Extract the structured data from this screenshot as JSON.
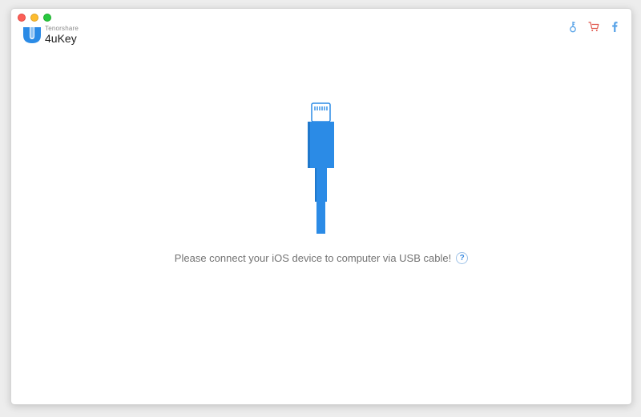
{
  "app": {
    "vendor": "Tenorshare",
    "name": "4uKey"
  },
  "colors": {
    "accent": "#2b8be6",
    "cart": "#e0584e",
    "key": "#5aa4e8",
    "facebook": "#5aa4e8"
  },
  "header": {
    "actions": [
      {
        "icon": "key-icon"
      },
      {
        "icon": "cart-icon"
      },
      {
        "icon": "facebook-icon"
      }
    ]
  },
  "main": {
    "illustration": "lightning-cable-icon",
    "message": "Please connect your iOS device to computer via USB cable!",
    "help_label": "?"
  }
}
